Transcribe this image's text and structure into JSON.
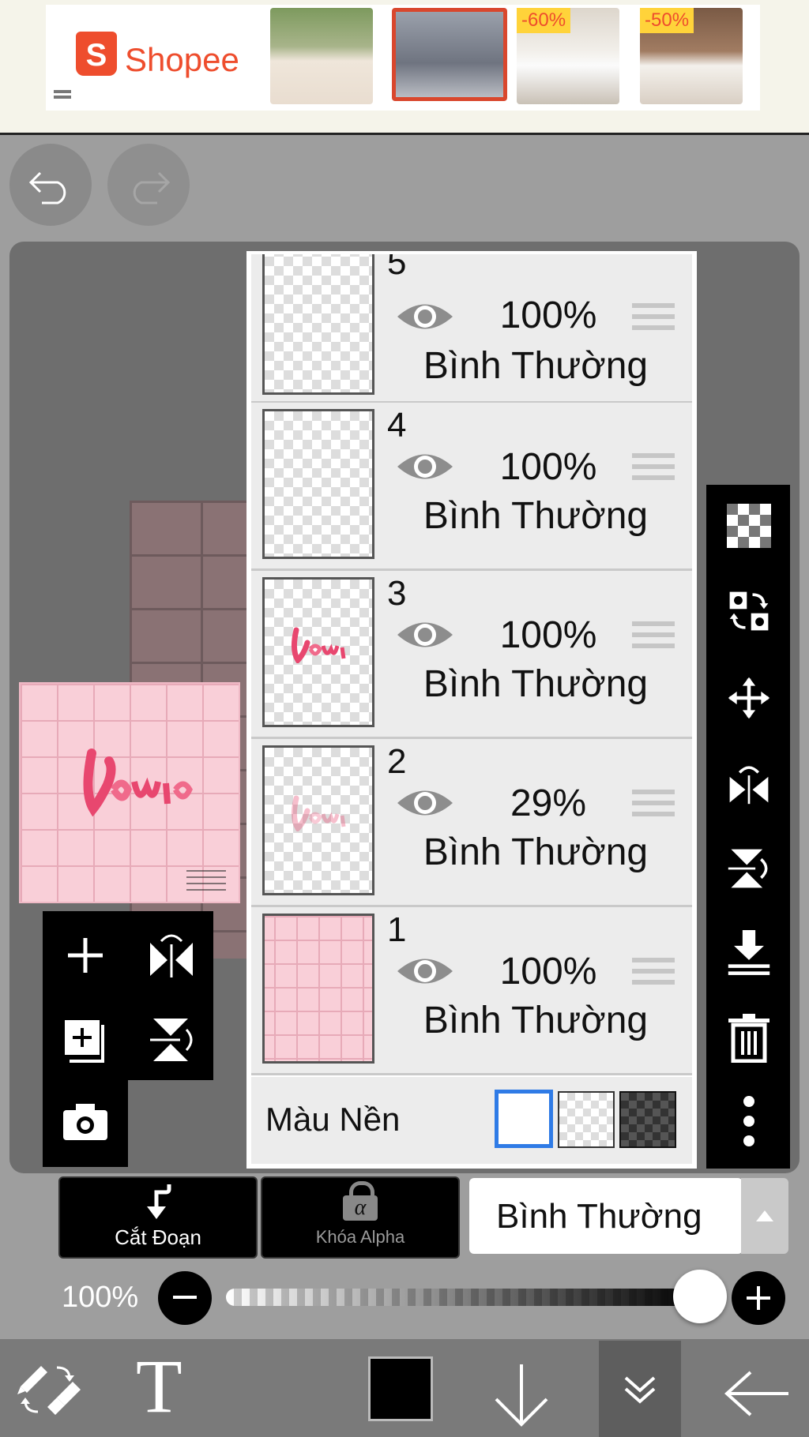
{
  "ad": {
    "brand": "Shopee",
    "discounts": [
      "-60%",
      "-50%"
    ]
  },
  "layers": [
    {
      "number": "5",
      "opacity": "100%",
      "mode": "Bình Thường"
    },
    {
      "number": "4",
      "opacity": "100%",
      "mode": "Bình Thường"
    },
    {
      "number": "3",
      "opacity": "100%",
      "mode": "Bình Thường"
    },
    {
      "number": "2",
      "opacity": "29%",
      "mode": "Bình Thường"
    },
    {
      "number": "1",
      "opacity": "100%",
      "mode": "Bình Thường"
    }
  ],
  "background_color": {
    "label": "Màu Nền"
  },
  "actions": {
    "clip_label": "Cắt Đoạn",
    "alpha_lock_label": "Khóa Alpha",
    "blend_mode": "Bình Thường",
    "alpha_glyph": "α"
  },
  "opacity_slider": {
    "label": "100%",
    "value": 1.0
  },
  "bottom": {
    "text_tool": "T"
  },
  "colors": {
    "brand": "#ee4d2d",
    "selected_border": "#2f7be6",
    "foreground": "#000000"
  }
}
